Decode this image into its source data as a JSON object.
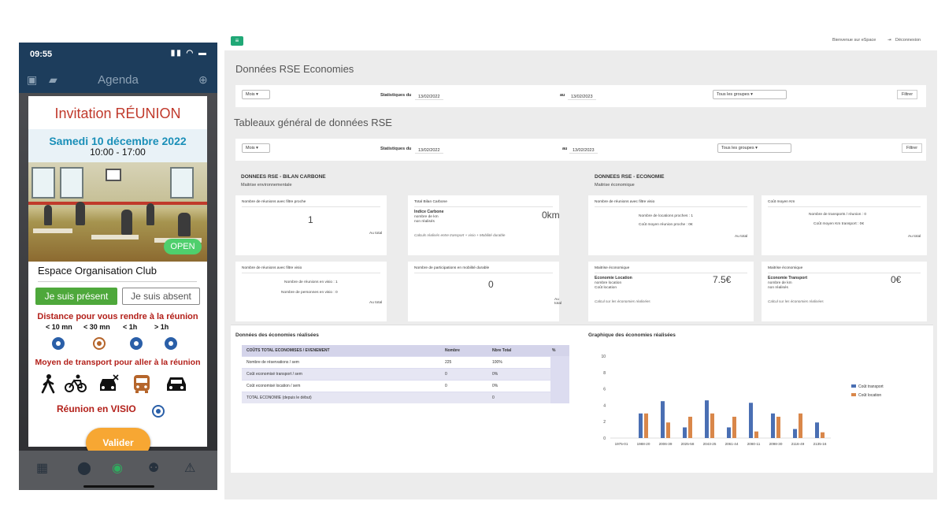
{
  "phone": {
    "status_time": "09:55",
    "appbar_title": "Agenda",
    "invitation_title": "Invitation RÉUNION",
    "date": "Samedi 10 décembre 2022",
    "hours": "10:00 - 17:00",
    "open_badge": "OPEN",
    "venue": "Espace Organisation Club",
    "btn_present": "Je suis présent",
    "btn_absent": "Je suis absent",
    "distance_title": "Distance pour vous rendre à la réunion",
    "distance_options": [
      "< 10 mn",
      "< 30 mn",
      "< 1h",
      "> 1h"
    ],
    "transport_title": "Moyen de transport pour aller à la réunion",
    "transport_icons": [
      "walk-icon",
      "bicycle-icon",
      "carpool-icon",
      "bus-icon",
      "car-icon"
    ],
    "visio_label": "Réunion en VISIO",
    "validate_button": "Valider",
    "bottom_nav": [
      "calendar-icon",
      "map-pin-icon",
      "eye-icon",
      "people-icon",
      "warning-icon"
    ]
  },
  "dashboard": {
    "welcome": "Bienvenue sur eSpace",
    "logout": "Déconnexion",
    "section1_title": "Données RSE Economies",
    "section2_title": "Tableaux général de données RSE",
    "filter1": {
      "period": "Mois",
      "stats_label": "Statistiques du",
      "from": "13/02/2022",
      "to_label": "au",
      "to": "13/02/2023",
      "group": "Tous les groupes",
      "button": "Filtrer"
    },
    "filter2": {
      "period": "Mois",
      "stats_label": "Statistiques du",
      "from": "13/02/2022",
      "to_label": "au",
      "to": "13/02/2023",
      "group": "Tous les groupes",
      "button": "Filtrer"
    },
    "carbon": {
      "head": "DONNEES RSE - BILAN CARBONE",
      "sub": "Maitrise environnementale",
      "card1": {
        "title": "Nombre de réunions avec filtre proche",
        "value": "1",
        "foot": "Au total"
      },
      "card2": {
        "title": "Total Bilan Carbone",
        "label": "Indice Carbone",
        "l2": "nombre de km",
        "l3": "non réalisés",
        "value": "0km",
        "note": "Calculs réalisés entre transport + visio + Mobilité durable"
      },
      "card3": {
        "title": "Nombre de réunions avec filtre visio",
        "l1": "Nombre de réunions en visio : 1",
        "l2": "Nombre de personnes en visio : 0",
        "foot": "Au total"
      },
      "card4": {
        "title": "Nombre de participations en mobilité durable",
        "value": "0",
        "foot": "Au total"
      }
    },
    "economy": {
      "head": "DONNEES RSE - ECONOMIE",
      "sub": "Maitrise économique",
      "card1": {
        "title": "Nombre de réunions avec filtre visio",
        "l1": "Nombre de locations proches : 1",
        "l2": "Coût moyen réunion proche : 0€",
        "foot": "Au total"
      },
      "card2": {
        "title": "Coût moyen Km",
        "l1": "Nombre de transports / réunion : 0",
        "l2": "Coût moyen Km transport : 0€",
        "foot": "Au total"
      },
      "card3": {
        "title": "Maitrise économique",
        "label": "Economie Location",
        "l2": "nombre location",
        "l3": "Coût location",
        "value": "7.5€",
        "note": "Calcul sur les économies réalisées"
      },
      "card4": {
        "title": "Maitrise économique",
        "label": "Economie Transport",
        "l2": "nombre de km",
        "l3": "non réalisés",
        "value": "0€",
        "note": "Calcul sur les économies réalisées"
      }
    },
    "savings_table": {
      "title": "Données des économies réalisées",
      "headers": [
        "COÛTS TOTAL ECONOMISES / EVENEMENT",
        "Nombre",
        "Nbre Total",
        "%"
      ],
      "rows": [
        [
          "Nombre de réservations / sem",
          "225",
          "100%",
          ""
        ],
        [
          "Coût economisé transport / sem",
          "0",
          "0%",
          ""
        ],
        [
          "Coût economisé location / sem",
          "0",
          "0%",
          ""
        ],
        [
          "TOTAL ECONOMIE (depuis le début)",
          "",
          "0",
          ""
        ]
      ]
    },
    "colors": {
      "accent": "#20a876",
      "series_transport": "#4a6fb3",
      "series_location": "#d9874a"
    }
  },
  "chart_data": {
    "type": "bar",
    "title": "Graphique des économies réalisées",
    "categories": [
      "1975-01",
      "1988-20",
      "2006-39",
      "2025-58",
      "2043-25",
      "2061-44",
      "2080-11",
      "2098-30",
      "2116-49",
      "2135-16"
    ],
    "series": [
      {
        "name": "Coût transport",
        "values": [
          0,
          3,
          4.5,
          1.3,
          4.6,
          1.3,
          4.3,
          3,
          1.1,
          1.9
        ]
      },
      {
        "name": "Coût location",
        "values": [
          0,
          3,
          1.9,
          2.6,
          3,
          2.6,
          0.8,
          2.6,
          3,
          0.7
        ]
      }
    ],
    "yticks": [
      0,
      2,
      4,
      6,
      8,
      10
    ],
    "ylim": [
      0,
      10
    ],
    "legend": "right"
  }
}
